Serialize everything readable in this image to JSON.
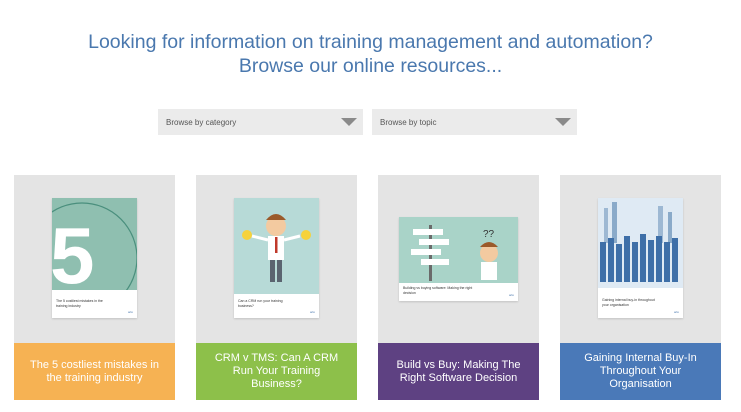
{
  "header": {
    "line1": "Looking for information on training management and automation?",
    "line2": "Browse our online resources..."
  },
  "filters": {
    "category_label": "Browse by category",
    "topic_label": "Browse by topic"
  },
  "colors": {
    "heading": "#4a78ae",
    "card_orange": "#f6b253",
    "card_green": "#8dc04a",
    "card_purple": "#5e4182",
    "card_blue": "#4a79b8"
  },
  "cards": [
    {
      "title": "The 5 costliest mistakes in the training industry",
      "cover_big": "5",
      "cover_caption": "The 5 costliest mistakes in the training industry",
      "logo": "arlo"
    },
    {
      "title": "CRM v TMS: Can A CRM Run Your Training Business?",
      "cover_caption": "Can a CRM run your training business?",
      "logo": "arlo"
    },
    {
      "title": "Build vs Buy: Making The Right Software Decision",
      "cover_caption": "Building vs buying software: Making the right decision",
      "logo": "arlo"
    },
    {
      "title": "Gaining Internal Buy-In Throughout Your Organisation",
      "cover_caption": "Gaining internal buy-in throughout your organisation",
      "logo": "arlo"
    }
  ]
}
